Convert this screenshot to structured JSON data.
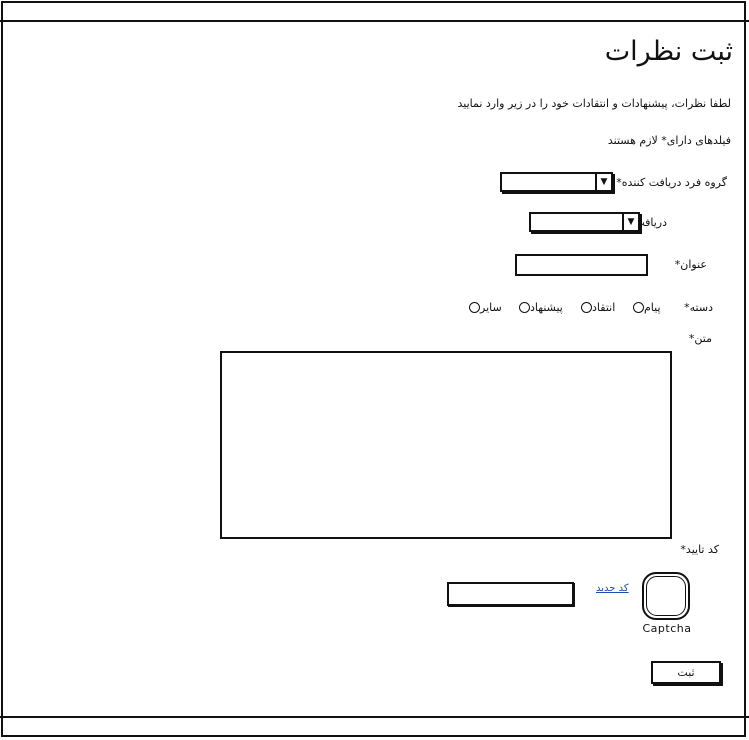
{
  "page": {
    "title": "ثبت نظرات",
    "instructions": "لطفا نظرات، پیشنهادات و انتقادات خود را در زیر وارد نمایید",
    "required_note": "فیلدهای دارای* لازم هستند"
  },
  "form": {
    "recipient_group_label": "گروه فرد دریافت کننده*",
    "recipient_label": "دریافت کننده*",
    "subject_label": "عنوان*",
    "category_label": "دسته*",
    "category_options": [
      "پیام",
      "انتقاد",
      "پیشنهاد",
      "سایر"
    ],
    "text_label": "متن*",
    "captcha_label": "کد تایید*",
    "new_code_link": "کد جدید",
    "captcha_image_label": "Captcha",
    "submit_label": "ثبت",
    "dropdown_arrow": "▼"
  }
}
